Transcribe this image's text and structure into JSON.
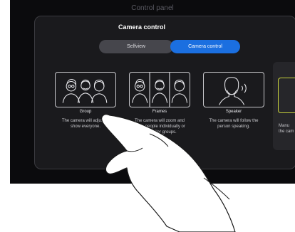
{
  "panel": {
    "title": "Control panel"
  },
  "modal": {
    "title": "Camera control"
  },
  "segmented": {
    "selfview_label": "Selfview",
    "camera_control_label": "Camera control",
    "selected": "Camera control"
  },
  "modes": [
    {
      "name": "Group",
      "description_lines": [
        "The camera will adjust to",
        "show everyone."
      ],
      "icon": "group-icon"
    },
    {
      "name": "Frames",
      "description_lines": [
        "The camera will zoom and",
        "show people individually or",
        "in smaller groups."
      ],
      "icon": "frames-icon"
    },
    {
      "name": "Speaker",
      "description_lines": [
        "The camera will follow the",
        "person speaking."
      ],
      "icon": "speaker-icon"
    },
    {
      "name": "Manu",
      "description_lines": [
        "Manu",
        "the cam"
      ],
      "icon": "manual-icon"
    }
  ],
  "colors": {
    "accent": "#1b6fe0",
    "background": "#0b0b0d",
    "modal": "#1a1a1d",
    "manual_icon_outline": "#c8d23c"
  }
}
